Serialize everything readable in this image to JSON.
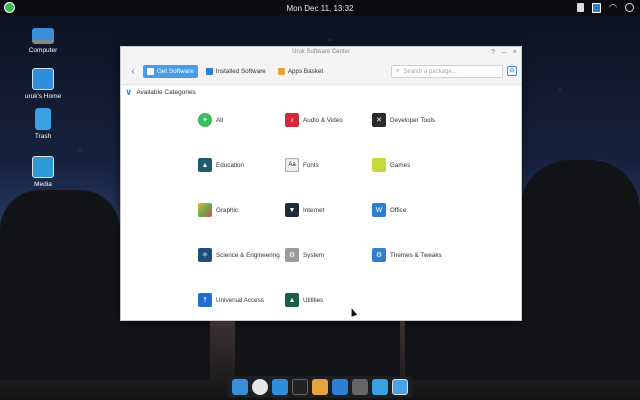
{
  "topbar": {
    "clock": "Mon Dec 11, 13:32"
  },
  "desktop": {
    "icons": [
      {
        "label": "Computer"
      },
      {
        "label": "uruk's Home"
      },
      {
        "label": "Trash"
      },
      {
        "label": "Media"
      }
    ]
  },
  "window": {
    "title": "Uruk Software Center",
    "toolbar": {
      "get_software": "Get Software",
      "installed_software": "Installed Software",
      "apps_basket": "Apps Basket",
      "search_placeholder": "Search a package..."
    },
    "section_title": "Available Categories",
    "categories": [
      {
        "label": "All",
        "icon": "all-icon",
        "color": "#3dbb5b"
      },
      {
        "label": "Audio & Video",
        "icon": "music-icon",
        "color": "#d6283b"
      },
      {
        "label": "Developer Tools",
        "icon": "tools-icon",
        "color": "#2b2b2b"
      },
      {
        "label": "Education",
        "icon": "education-icon",
        "color": "#1f5b6e"
      },
      {
        "label": "Fonts",
        "icon": "fonts-icon",
        "color": "#d9d9d9"
      },
      {
        "label": "Games",
        "icon": "games-icon",
        "color": "#c4d93a"
      },
      {
        "label": "Graphic",
        "icon": "graphic-icon",
        "color": "#6aa84f"
      },
      {
        "label": "Internet",
        "icon": "internet-icon",
        "color": "#1c2b3a"
      },
      {
        "label": "Office",
        "icon": "office-icon",
        "color": "#2f7fd1"
      },
      {
        "label": "Science & Engineering",
        "icon": "science-icon",
        "color": "#1d4f7a"
      },
      {
        "label": "System",
        "icon": "system-icon",
        "color": "#8a8a8a"
      },
      {
        "label": "Themes & Tweaks",
        "icon": "themes-icon",
        "color": "#2f7fd1"
      },
      {
        "label": "Universal Access",
        "icon": "accessibility-icon",
        "color": "#1f6fd1"
      },
      {
        "label": "Utilities",
        "icon": "utilities-icon",
        "color": "#1b5e4a"
      }
    ]
  }
}
